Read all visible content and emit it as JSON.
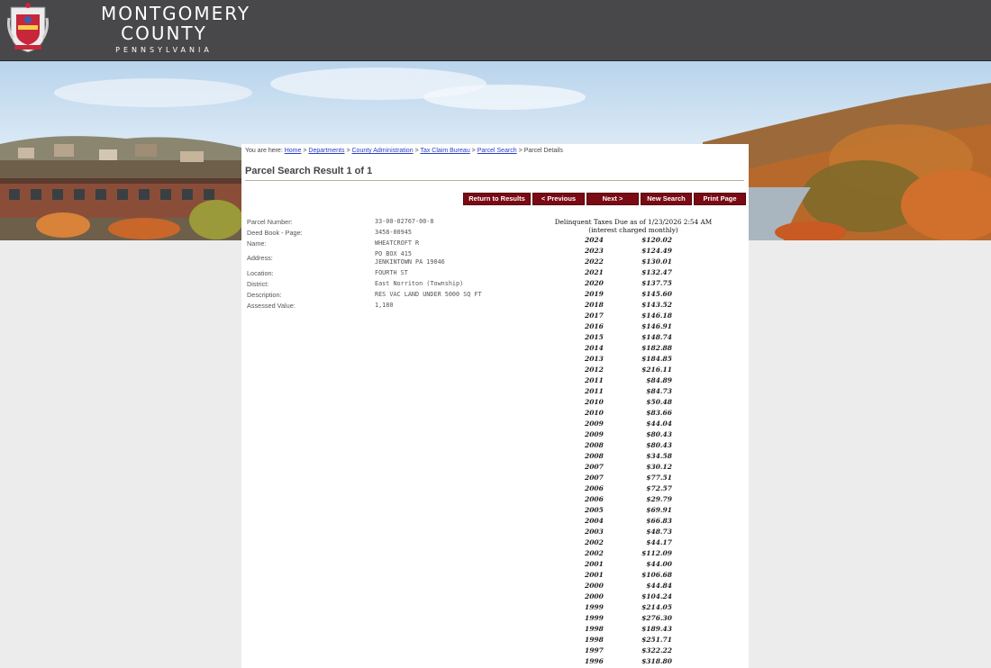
{
  "header": {
    "brand_line1": "MONTGOMERY",
    "brand_line2": "COUNTY",
    "brand_line3": "PENNSYLVANIA"
  },
  "breadcrumb": {
    "prefix": "You are here:",
    "items": [
      "Home",
      "Departments",
      "County Administration",
      "Tax Claim Bureau",
      "Parcel Search"
    ],
    "separator": ">",
    "current": "Parcel Details"
  },
  "page_title": "Parcel Search Result 1 of 1",
  "buttons": {
    "return": "Return to Results",
    "previous": "< Previous",
    "next": "Next >",
    "new_search": "New Search",
    "print": "Print Page"
  },
  "parcel": {
    "parcel_number_label": "Parcel Number:",
    "parcel_number": "33-00-02767-00-8",
    "deed_label": "Deed Book - Page:",
    "deed": "3458-00945",
    "name_label": "Name:",
    "name": "WHEATCROFT R",
    "address_label": "Address:",
    "address_line1": "PO BOX 415",
    "address_line2": "JENKINTOWN PA 19046",
    "location_label": "Location:",
    "location": "FOURTH ST",
    "district_label": "District:",
    "district": "East Norriton (Township)",
    "description_label": "Description:",
    "description": "RES VAC LAND UNDER 5000 SQ FT",
    "assessed_label": "Assessed Value:",
    "assessed": "1,180"
  },
  "taxes": {
    "heading_line1": "Delinquent Taxes Due as of 1/23/2026  2:54 AM",
    "heading_line2": "(interest charged monthly)",
    "rows": [
      {
        "year": "2024",
        "amount": "$120.02"
      },
      {
        "year": "2023",
        "amount": "$124.49"
      },
      {
        "year": "2022",
        "amount": "$130.01"
      },
      {
        "year": "2021",
        "amount": "$132.47"
      },
      {
        "year": "2020",
        "amount": "$137.75"
      },
      {
        "year": "2019",
        "amount": "$145.60"
      },
      {
        "year": "2018",
        "amount": "$143.52"
      },
      {
        "year": "2017",
        "amount": "$146.18"
      },
      {
        "year": "2016",
        "amount": "$146.91"
      },
      {
        "year": "2015",
        "amount": "$148.74"
      },
      {
        "year": "2014",
        "amount": "$182.88"
      },
      {
        "year": "2013",
        "amount": "$184.85"
      },
      {
        "year": "2012",
        "amount": "$216.11"
      },
      {
        "year": "2011",
        "amount": "$84.89"
      },
      {
        "year": "2011",
        "amount": "$84.73"
      },
      {
        "year": "2010",
        "amount": "$50.48"
      },
      {
        "year": "2010",
        "amount": "$83.66"
      },
      {
        "year": "2009",
        "amount": "$44.04"
      },
      {
        "year": "2009",
        "amount": "$80.43"
      },
      {
        "year": "2008",
        "amount": "$80.43"
      },
      {
        "year": "2008",
        "amount": "$34.58"
      },
      {
        "year": "2007",
        "amount": "$30.12"
      },
      {
        "year": "2007",
        "amount": "$77.51"
      },
      {
        "year": "2006",
        "amount": "$72.57"
      },
      {
        "year": "2006",
        "amount": "$29.79"
      },
      {
        "year": "2005",
        "amount": "$69.91"
      },
      {
        "year": "2004",
        "amount": "$66.83"
      },
      {
        "year": "2003",
        "amount": "$48.73"
      },
      {
        "year": "2002",
        "amount": "$44.17"
      },
      {
        "year": "2002",
        "amount": "$112.09"
      },
      {
        "year": "2001",
        "amount": "$44.00"
      },
      {
        "year": "2001",
        "amount": "$106.68"
      },
      {
        "year": "2000",
        "amount": "$44.84"
      },
      {
        "year": "2000",
        "amount": "$104.24"
      },
      {
        "year": "1999",
        "amount": "$214.05"
      },
      {
        "year": "1999",
        "amount": "$276.30"
      },
      {
        "year": "1998",
        "amount": "$189.43"
      },
      {
        "year": "1998",
        "amount": "$251.71"
      },
      {
        "year": "1997",
        "amount": "$322.22"
      },
      {
        "year": "1996",
        "amount": "$318.80"
      }
    ]
  },
  "colors": {
    "header_bg": "#48474a",
    "button_bg": "#7a0a13",
    "link": "#2a3fc9"
  }
}
